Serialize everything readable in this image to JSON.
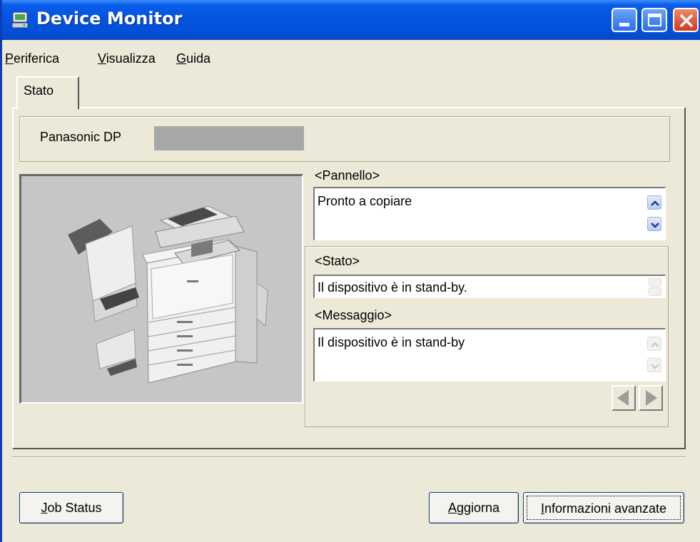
{
  "window": {
    "title": "Device Monitor",
    "icon": "device-monitor-icon",
    "controls": [
      "minimize-icon",
      "maximize-icon",
      "close-icon"
    ]
  },
  "menu": {
    "items": [
      {
        "accel": "P",
        "rest": "eriferica"
      },
      {
        "accel": "V",
        "rest": "isualizza"
      },
      {
        "accel": "G",
        "rest": "uida"
      }
    ]
  },
  "tabs": [
    {
      "label": "Stato",
      "selected": true
    }
  ],
  "device": {
    "name_prefix": "Panasonic DP",
    "image": "multifunction-copier-image"
  },
  "panel": {
    "label": "<Pannello>",
    "text": "Pronto a copiare"
  },
  "status_group": {
    "stato_label": "<Stato>",
    "stato_text": "Il dispositivo è in stand-by.",
    "messaggio_label": "<Messaggio>",
    "messaggio_text": "Il dispositivo è in stand-by"
  },
  "buttons": {
    "job_status": {
      "accel": "J",
      "rest": "ob Status"
    },
    "aggiorna": {
      "accel": "A",
      "rest": "ggiorna"
    },
    "informazioni": {
      "accel": "I",
      "rest": "nformazioni avanzate"
    }
  },
  "colors": {
    "titlebar": "#0453e0",
    "window_bg": "#ece9d8",
    "close_button": "#d3391c"
  }
}
